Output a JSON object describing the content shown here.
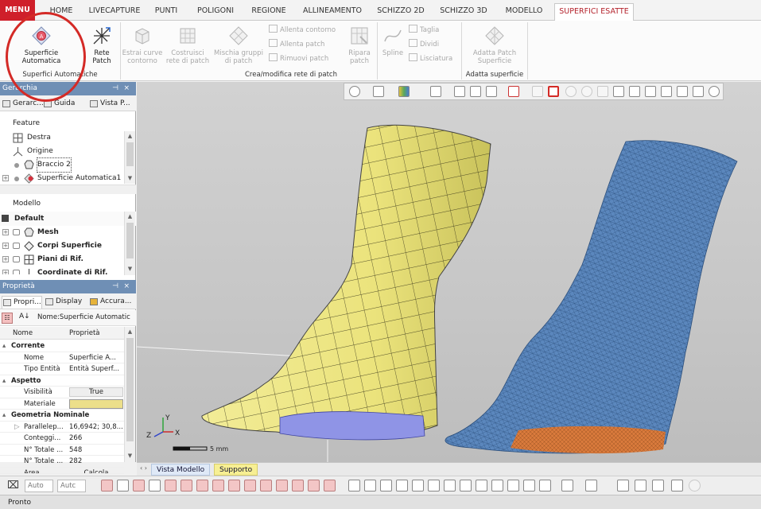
{
  "menubar": {
    "menu_label": "MENU",
    "tabs": [
      "HOME",
      "LIVECAPTURE",
      "PUNTI",
      "POLIGONI",
      "REGIONE",
      "ALLINEAMENTO",
      "SCHIZZO 2D",
      "SCHIZZO 3D",
      "MODELLO",
      "SUPERFICI ESATTE"
    ],
    "active_tab": "SUPERFICI ESATTE"
  },
  "ribbon": {
    "superficie_automatica": "Superficie Automatica",
    "rete_patch": "Rete Patch",
    "estrai_curve": "Estrai curve contorno",
    "costruisci_rete": "Costruisci rete di patch",
    "mischia_gruppi": "Mischia gruppi di patch",
    "allenta_contorno": "Allenta contorno",
    "allenta_patch": "Allenta patch",
    "rimuovi_patch": "Rimuovi patch",
    "ripara_patch": "Ripara patch",
    "spline": "Spline",
    "taglia": "Taglia",
    "dividi": "Dividi",
    "lisciatura": "Lisciatura",
    "adatta_patch": "Adatta Patch Superficie",
    "groups": [
      "Superfici Automatiche",
      "Crea/modifica rete di patch",
      "Adatta superficie"
    ]
  },
  "hierarchy": {
    "title": "Gerarchia",
    "tabs": [
      "Gerarc...",
      "Guida",
      "Vista P..."
    ],
    "feature_header": "Feature",
    "feature_items": [
      "Destra",
      "Origine",
      "Braccio 2",
      "Superficie Automatica1"
    ],
    "model_header": "Modello",
    "model_group": "Default",
    "model_items": [
      "Mesh",
      "Corpi Superficie",
      "Piani di Rif.",
      "Coordinate di Rif."
    ]
  },
  "properties": {
    "title": "Proprietà",
    "tabs": [
      "Propri...",
      "Display",
      "Accura..."
    ],
    "name_field": "Nome:Superficie Automatic",
    "col_name": "Nome",
    "col_prop": "Proprietà",
    "cat_corrente": "Corrente",
    "rows_corrente": [
      {
        "k": "Nome",
        "v": "Superficie A..."
      },
      {
        "k": "Tipo Entità",
        "v": "Entità Superf..."
      }
    ],
    "cat_aspetto": "Aspetto",
    "rows_aspetto": [
      {
        "k": "Visibilità",
        "v": "True"
      },
      {
        "k": "Materiale",
        "v": ""
      }
    ],
    "cat_geometria": "Geometria Nominale",
    "rows_geometria": [
      {
        "k": "Parallelep...",
        "v": "16,6942; 30,8..."
      },
      {
        "k": "Conteggi...",
        "v": "266"
      },
      {
        "k": "N° Totale ...",
        "v": "548"
      },
      {
        "k": "N° Totale ...",
        "v": "282"
      },
      {
        "k": "Area",
        "v": "Calcola"
      }
    ],
    "material_color": "#ecdf8a"
  },
  "viewport": {
    "scale_label": "5 mm",
    "axis_x": "X",
    "axis_y": "Y",
    "axis_z": "Z"
  },
  "view_tabs": [
    "Vista Modello",
    "Supporto"
  ],
  "bottom_toolbar": {
    "combo1": "Auto",
    "combo2": "Autc"
  },
  "status": "Pronto",
  "colors": {
    "menu_red": "#cf1f2a",
    "panel_title": "#6f8fb5",
    "surface_yellow": "#ece581",
    "mesh_blue": "#5b87bd"
  }
}
